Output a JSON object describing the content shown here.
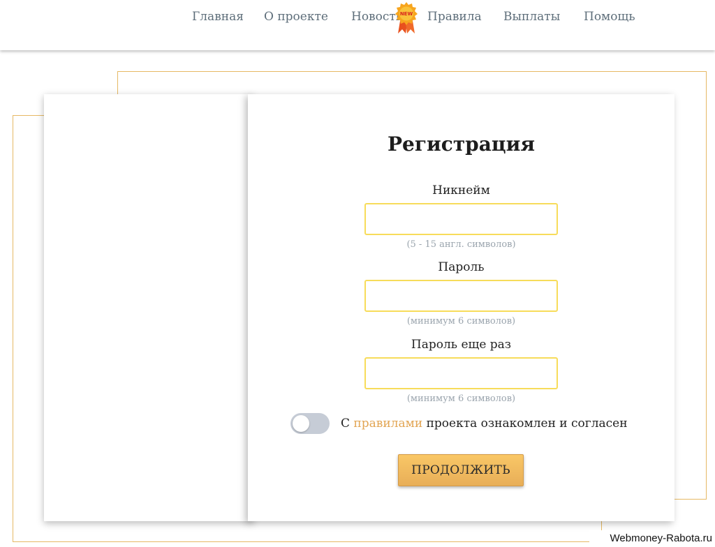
{
  "nav": {
    "items": [
      "Главная",
      "О проекте",
      "Новости",
      "Правила",
      "Выплаты",
      "Помощь"
    ],
    "new_badge": "NEW"
  },
  "form": {
    "title": "Регистрация",
    "nickname": {
      "label": "Никнейм",
      "value": "",
      "hint": "(5 - 15 англ. символов)"
    },
    "password": {
      "label": "Пароль",
      "value": "",
      "hint": "(минимум 6 символов)"
    },
    "password_repeat": {
      "label": "Пароль еще раз",
      "value": "",
      "hint": "(минимум 6 символов)"
    },
    "agree": {
      "prefix": "С",
      "link": "правилами",
      "suffix": "проекта ознакомлен и согласен",
      "checked": false
    },
    "submit_label": "ПРОДОЛЖИТЬ"
  },
  "watermark": "Webmoney-Rabota.ru",
  "colors": {
    "accent_gold": "#e6b964",
    "input_border": "#f7dc5a",
    "button": "#f4bd60",
    "link": "#e2a553",
    "nav_text": "#5e6e7a"
  }
}
